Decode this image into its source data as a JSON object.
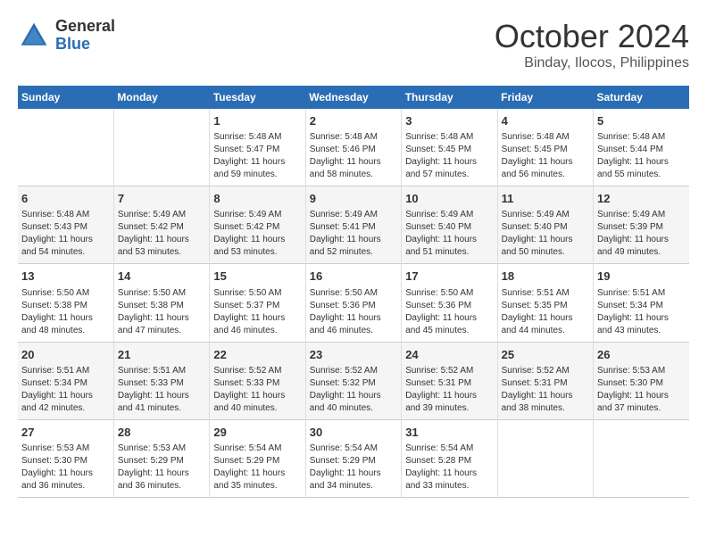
{
  "logo": {
    "general": "General",
    "blue": "Blue"
  },
  "title": "October 2024",
  "subtitle": "Binday, Ilocos, Philippines",
  "weekdays": [
    "Sunday",
    "Monday",
    "Tuesday",
    "Wednesday",
    "Thursday",
    "Friday",
    "Saturday"
  ],
  "weeks": [
    [
      {
        "day": "",
        "info": ""
      },
      {
        "day": "",
        "info": ""
      },
      {
        "day": "1",
        "info": "Sunrise: 5:48 AM\nSunset: 5:47 PM\nDaylight: 11 hours and 59 minutes."
      },
      {
        "day": "2",
        "info": "Sunrise: 5:48 AM\nSunset: 5:46 PM\nDaylight: 11 hours and 58 minutes."
      },
      {
        "day": "3",
        "info": "Sunrise: 5:48 AM\nSunset: 5:45 PM\nDaylight: 11 hours and 57 minutes."
      },
      {
        "day": "4",
        "info": "Sunrise: 5:48 AM\nSunset: 5:45 PM\nDaylight: 11 hours and 56 minutes."
      },
      {
        "day": "5",
        "info": "Sunrise: 5:48 AM\nSunset: 5:44 PM\nDaylight: 11 hours and 55 minutes."
      }
    ],
    [
      {
        "day": "6",
        "info": "Sunrise: 5:48 AM\nSunset: 5:43 PM\nDaylight: 11 hours and 54 minutes."
      },
      {
        "day": "7",
        "info": "Sunrise: 5:49 AM\nSunset: 5:42 PM\nDaylight: 11 hours and 53 minutes."
      },
      {
        "day": "8",
        "info": "Sunrise: 5:49 AM\nSunset: 5:42 PM\nDaylight: 11 hours and 53 minutes."
      },
      {
        "day": "9",
        "info": "Sunrise: 5:49 AM\nSunset: 5:41 PM\nDaylight: 11 hours and 52 minutes."
      },
      {
        "day": "10",
        "info": "Sunrise: 5:49 AM\nSunset: 5:40 PM\nDaylight: 11 hours and 51 minutes."
      },
      {
        "day": "11",
        "info": "Sunrise: 5:49 AM\nSunset: 5:40 PM\nDaylight: 11 hours and 50 minutes."
      },
      {
        "day": "12",
        "info": "Sunrise: 5:49 AM\nSunset: 5:39 PM\nDaylight: 11 hours and 49 minutes."
      }
    ],
    [
      {
        "day": "13",
        "info": "Sunrise: 5:50 AM\nSunset: 5:38 PM\nDaylight: 11 hours and 48 minutes."
      },
      {
        "day": "14",
        "info": "Sunrise: 5:50 AM\nSunset: 5:38 PM\nDaylight: 11 hours and 47 minutes."
      },
      {
        "day": "15",
        "info": "Sunrise: 5:50 AM\nSunset: 5:37 PM\nDaylight: 11 hours and 46 minutes."
      },
      {
        "day": "16",
        "info": "Sunrise: 5:50 AM\nSunset: 5:36 PM\nDaylight: 11 hours and 46 minutes."
      },
      {
        "day": "17",
        "info": "Sunrise: 5:50 AM\nSunset: 5:36 PM\nDaylight: 11 hours and 45 minutes."
      },
      {
        "day": "18",
        "info": "Sunrise: 5:51 AM\nSunset: 5:35 PM\nDaylight: 11 hours and 44 minutes."
      },
      {
        "day": "19",
        "info": "Sunrise: 5:51 AM\nSunset: 5:34 PM\nDaylight: 11 hours and 43 minutes."
      }
    ],
    [
      {
        "day": "20",
        "info": "Sunrise: 5:51 AM\nSunset: 5:34 PM\nDaylight: 11 hours and 42 minutes."
      },
      {
        "day": "21",
        "info": "Sunrise: 5:51 AM\nSunset: 5:33 PM\nDaylight: 11 hours and 41 minutes."
      },
      {
        "day": "22",
        "info": "Sunrise: 5:52 AM\nSunset: 5:33 PM\nDaylight: 11 hours and 40 minutes."
      },
      {
        "day": "23",
        "info": "Sunrise: 5:52 AM\nSunset: 5:32 PM\nDaylight: 11 hours and 40 minutes."
      },
      {
        "day": "24",
        "info": "Sunrise: 5:52 AM\nSunset: 5:31 PM\nDaylight: 11 hours and 39 minutes."
      },
      {
        "day": "25",
        "info": "Sunrise: 5:52 AM\nSunset: 5:31 PM\nDaylight: 11 hours and 38 minutes."
      },
      {
        "day": "26",
        "info": "Sunrise: 5:53 AM\nSunset: 5:30 PM\nDaylight: 11 hours and 37 minutes."
      }
    ],
    [
      {
        "day": "27",
        "info": "Sunrise: 5:53 AM\nSunset: 5:30 PM\nDaylight: 11 hours and 36 minutes."
      },
      {
        "day": "28",
        "info": "Sunrise: 5:53 AM\nSunset: 5:29 PM\nDaylight: 11 hours and 36 minutes."
      },
      {
        "day": "29",
        "info": "Sunrise: 5:54 AM\nSunset: 5:29 PM\nDaylight: 11 hours and 35 minutes."
      },
      {
        "day": "30",
        "info": "Sunrise: 5:54 AM\nSunset: 5:29 PM\nDaylight: 11 hours and 34 minutes."
      },
      {
        "day": "31",
        "info": "Sunrise: 5:54 AM\nSunset: 5:28 PM\nDaylight: 11 hours and 33 minutes."
      },
      {
        "day": "",
        "info": ""
      },
      {
        "day": "",
        "info": ""
      }
    ]
  ]
}
